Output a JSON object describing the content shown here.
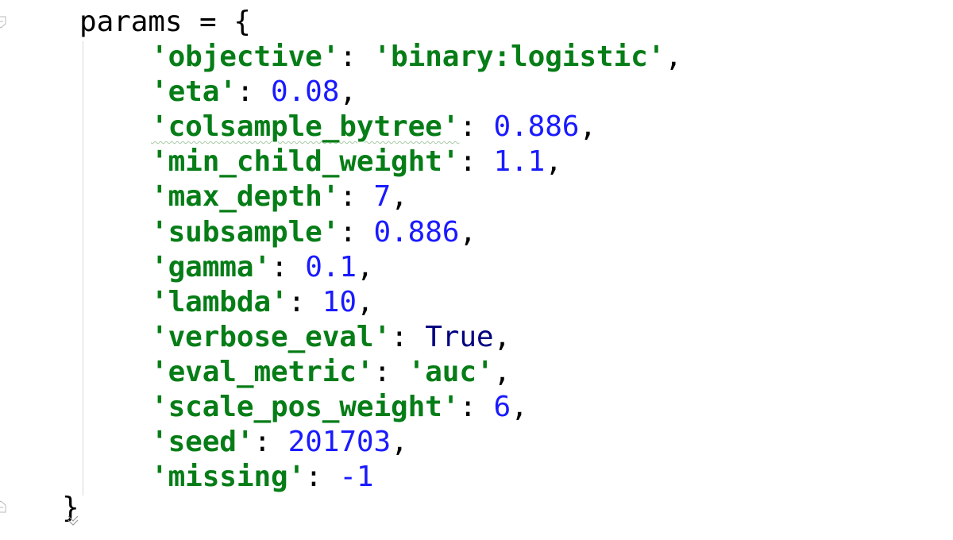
{
  "editor": {
    "opening": {
      "var": "params",
      "op": " = ",
      "brace": "{"
    },
    "entries": [
      {
        "key": "'objective'",
        "sep": ": ",
        "value": "'binary:logistic'",
        "type": "str",
        "end": ","
      },
      {
        "key": "'eta'",
        "sep": ": ",
        "value": "0.08",
        "type": "num",
        "end": ","
      },
      {
        "key": "'colsample_bytree'",
        "sep": ": ",
        "value": "0.886",
        "type": "num",
        "end": ","
      },
      {
        "key": "'min_child_weight'",
        "sep": ": ",
        "value": "1.1",
        "type": "num",
        "end": ","
      },
      {
        "key": "'max_depth'",
        "sep": ": ",
        "value": "7",
        "type": "num",
        "end": ","
      },
      {
        "key": "'subsample'",
        "sep": ": ",
        "value": "0.886",
        "type": "num",
        "end": ","
      },
      {
        "key": "'gamma'",
        "sep": ": ",
        "value": "0.1",
        "type": "num",
        "end": ","
      },
      {
        "key": "'lambda'",
        "sep": ": ",
        "value": "10",
        "type": "num",
        "end": ","
      },
      {
        "key": "'verbose_eval'",
        "sep": ": ",
        "value": "True",
        "type": "kw",
        "end": ","
      },
      {
        "key": "'eval_metric'",
        "sep": ": ",
        "value": "'auc'",
        "type": "str",
        "end": ","
      },
      {
        "key": "'scale_pos_weight'",
        "sep": ": ",
        "value": "6",
        "type": "num",
        "end": ","
      },
      {
        "key": "'seed'",
        "sep": ": ",
        "value": "201703",
        "type": "num",
        "end": ","
      },
      {
        "key": "'missing'",
        "sep": ": ",
        "value": "-1",
        "type": "num",
        "end": ""
      }
    ],
    "closing": {
      "brace": "}"
    },
    "icons": {
      "fold_top": "fold-start-icon",
      "fold_bottom": "fold-end-icon"
    },
    "colors": {
      "string": "#067d17",
      "number": "#1a1aff",
      "keyword": "#000080",
      "identifier": "#000000"
    }
  }
}
